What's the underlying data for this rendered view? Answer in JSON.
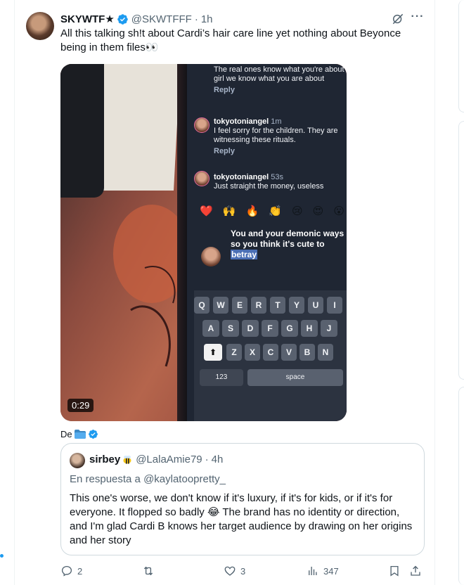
{
  "tweet": {
    "author_name": "SKYWTF★",
    "handle": "@SKWTFFF",
    "separator": "·",
    "time": "1h",
    "text": "All this talking sh!t about Cardi’s hair care line yet nothing about Beyonce being in them files👀",
    "video_duration": "0:29",
    "translation_prefix": "De"
  },
  "video_frame": {
    "comments": [
      {
        "text": "The real ones know what you're about girl we know what you are about",
        "reply": "Reply"
      },
      {
        "user": "tokyotoniangel",
        "age": "1m",
        "text": "I feel sorry for the children. They are witnessing these rituals.",
        "reply": "Reply"
      },
      {
        "user": "tokyotoniangel",
        "age": "53s",
        "text": "Just straight the money, useless"
      }
    ],
    "emojis": [
      "❤️",
      "🙌",
      "🔥",
      "👏",
      "😢",
      "😍",
      "😮"
    ],
    "compose_text": "You and your demonic ways so you think it's cute to",
    "compose_selected": "betray",
    "keyboard_row1": [
      "Q",
      "W",
      "E",
      "R",
      "T",
      "Y",
      "U",
      "I"
    ],
    "keyboard_row2": [
      "A",
      "S",
      "D",
      "F",
      "G",
      "H",
      "J"
    ],
    "keyboard_row3": [
      "Z",
      "X",
      "C",
      "V",
      "B",
      "N"
    ],
    "key_123": "123",
    "key_space": "space"
  },
  "quote": {
    "name": "sirbey",
    "handle": "@LalaAmie79",
    "separator": "·",
    "time": "4h",
    "reply_to": "En respuesta a @kaylatoopretty_",
    "text": "This one's worse, we don't know if it's luxury, if it's for kids, or if it's for everyone. It flopped so badly 😂 The brand has no identity or direction, and I'm glad Cardi B knows her target audience by drawing on her origins and her story"
  },
  "actions": {
    "replies": "2",
    "reposts": "",
    "likes": "3",
    "views": "347"
  },
  "colors": {
    "verified": "#1d9bf0",
    "secondary_text": "#536471",
    "border": "#cfd9de"
  },
  "icons": [
    "verified-icon",
    "grok-icon",
    "more-icon",
    "folder-icon",
    "bee-icon",
    "reply-icon",
    "repost-icon",
    "like-icon",
    "views-icon",
    "bookmark-icon",
    "share-icon"
  ]
}
